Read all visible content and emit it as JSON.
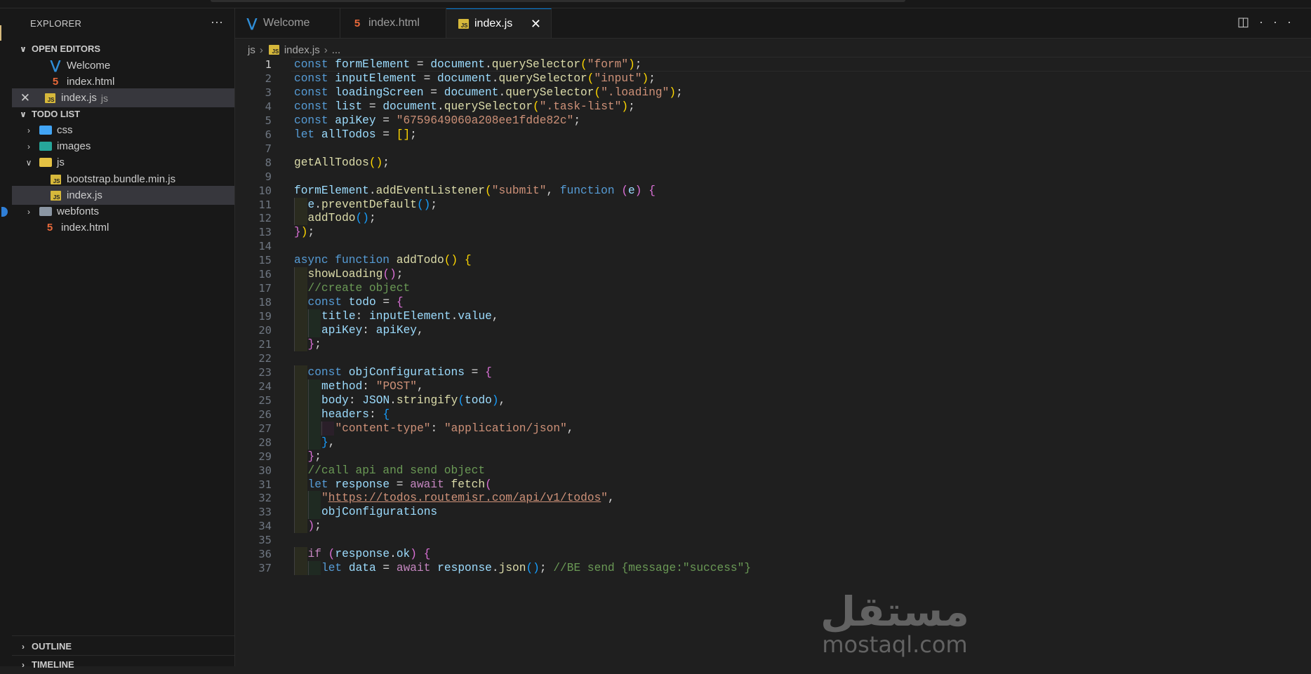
{
  "sidebar": {
    "title": "EXPLORER",
    "more": "···",
    "open_editors": {
      "label": "OPEN EDITORS",
      "items": [
        {
          "name": "Welcome"
        },
        {
          "name": "index.html"
        },
        {
          "name": "index.js",
          "hint": "js"
        }
      ]
    },
    "project": {
      "label": "TODO LIST",
      "items": [
        {
          "name": "css"
        },
        {
          "name": "images"
        },
        {
          "name": "js"
        },
        {
          "name": "bootstrap.bundle.min.js"
        },
        {
          "name": "index.js"
        },
        {
          "name": "webfonts"
        },
        {
          "name": "index.html"
        }
      ]
    },
    "outline": "OUTLINE",
    "timeline": "TIMELINE"
  },
  "tabs": [
    {
      "label": "Welcome"
    },
    {
      "label": "index.html"
    },
    {
      "label": "index.js",
      "active": true
    }
  ],
  "breadcrumb": {
    "folder": "js",
    "file": "index.js",
    "rest": "..."
  },
  "watermark": {
    "arabic": "مستقل",
    "latin": "mostaql.com"
  },
  "code": {
    "first_line_number": 1,
    "active_line": 1,
    "lines": [
      [
        [
          "k",
          "const "
        ],
        [
          "v",
          "formElement"
        ],
        [
          "p",
          " = "
        ],
        [
          "v",
          "document"
        ],
        [
          "p",
          "."
        ],
        [
          "f",
          "querySelector"
        ],
        [
          "b1",
          "("
        ],
        [
          "s",
          "\"form\""
        ],
        [
          "b1",
          ")"
        ],
        [
          "p",
          ";"
        ]
      ],
      [
        [
          "k",
          "const "
        ],
        [
          "v",
          "inputElement"
        ],
        [
          "p",
          " = "
        ],
        [
          "v",
          "document"
        ],
        [
          "p",
          "."
        ],
        [
          "f",
          "querySelector"
        ],
        [
          "b1",
          "("
        ],
        [
          "s",
          "\"input\""
        ],
        [
          "b1",
          ")"
        ],
        [
          "p",
          ";"
        ]
      ],
      [
        [
          "k",
          "const "
        ],
        [
          "v",
          "loadingScreen"
        ],
        [
          "p",
          " = "
        ],
        [
          "v",
          "document"
        ],
        [
          "p",
          "."
        ],
        [
          "f",
          "querySelector"
        ],
        [
          "b1",
          "("
        ],
        [
          "s",
          "\".loading\""
        ],
        [
          "b1",
          ")"
        ],
        [
          "p",
          ";"
        ]
      ],
      [
        [
          "k",
          "const "
        ],
        [
          "v",
          "list"
        ],
        [
          "p",
          " = "
        ],
        [
          "v",
          "document"
        ],
        [
          "p",
          "."
        ],
        [
          "f",
          "querySelector"
        ],
        [
          "b1",
          "("
        ],
        [
          "s",
          "\".task-list\""
        ],
        [
          "b1",
          ")"
        ],
        [
          "p",
          ";"
        ]
      ],
      [
        [
          "k",
          "const "
        ],
        [
          "v",
          "apiKey"
        ],
        [
          "p",
          " = "
        ],
        [
          "s",
          "\"6759649060a208ee1fdde82c\""
        ],
        [
          "p",
          ";"
        ]
      ],
      [
        [
          "k",
          "let "
        ],
        [
          "v",
          "allTodos"
        ],
        [
          "p",
          " = "
        ],
        [
          "b1",
          "[]"
        ],
        [
          "p",
          ";"
        ]
      ],
      [],
      [
        [
          "f",
          "getAllTodos"
        ],
        [
          "b1",
          "()"
        ],
        [
          "p",
          ";"
        ]
      ],
      [],
      [
        [
          "v",
          "formElement"
        ],
        [
          "p",
          "."
        ],
        [
          "f",
          "addEventListener"
        ],
        [
          "b1",
          "("
        ],
        [
          "s",
          "\"submit\""
        ],
        [
          "p",
          ", "
        ],
        [
          "k",
          "function "
        ],
        [
          "b2",
          "("
        ],
        [
          "v",
          "e"
        ],
        [
          "b2",
          ")"
        ],
        [
          "p",
          " "
        ],
        [
          "b2",
          "{"
        ]
      ],
      [
        [
          "v",
          "e"
        ],
        [
          "p",
          "."
        ],
        [
          "f",
          "preventDefault"
        ],
        [
          "b3",
          "()"
        ],
        [
          "p",
          ";"
        ]
      ],
      [
        [
          "f",
          "addTodo"
        ],
        [
          "b3",
          "()"
        ],
        [
          "p",
          ";"
        ]
      ],
      [
        [
          "b2",
          "}"
        ],
        [
          "b1",
          ")"
        ],
        [
          "p",
          ";"
        ]
      ],
      [],
      [
        [
          "k",
          "async "
        ],
        [
          "k",
          "function "
        ],
        [
          "f",
          "addTodo"
        ],
        [
          "b1",
          "()"
        ],
        [
          "p",
          " "
        ],
        [
          "b1",
          "{"
        ]
      ],
      [
        [
          "f",
          "showLoading"
        ],
        [
          "b2",
          "()"
        ],
        [
          "p",
          ";"
        ]
      ],
      [
        [
          "cm",
          "//create object"
        ]
      ],
      [
        [
          "k",
          "const "
        ],
        [
          "v",
          "todo"
        ],
        [
          "p",
          " = "
        ],
        [
          "b2",
          "{"
        ]
      ],
      [
        [
          "v",
          "title"
        ],
        [
          "p",
          ": "
        ],
        [
          "v",
          "inputElement"
        ],
        [
          "p",
          "."
        ],
        [
          "v",
          "value"
        ],
        [
          "p",
          ","
        ]
      ],
      [
        [
          "v",
          "apiKey"
        ],
        [
          "p",
          ": "
        ],
        [
          "v",
          "apiKey"
        ],
        [
          "p",
          ","
        ]
      ],
      [
        [
          "b2",
          "}"
        ],
        [
          "p",
          ";"
        ]
      ],
      [],
      [
        [
          "k",
          "const "
        ],
        [
          "v",
          "objConfigurations"
        ],
        [
          "p",
          " = "
        ],
        [
          "b2",
          "{"
        ]
      ],
      [
        [
          "v",
          "method"
        ],
        [
          "p",
          ": "
        ],
        [
          "s",
          "\"POST\""
        ],
        [
          "p",
          ","
        ]
      ],
      [
        [
          "v",
          "body"
        ],
        [
          "p",
          ": "
        ],
        [
          "v",
          "JSON"
        ],
        [
          "p",
          "."
        ],
        [
          "f",
          "stringify"
        ],
        [
          "b3",
          "("
        ],
        [
          "v",
          "todo"
        ],
        [
          "b3",
          ")"
        ],
        [
          "p",
          ","
        ]
      ],
      [
        [
          "v",
          "headers"
        ],
        [
          "p",
          ": "
        ],
        [
          "b3",
          "{"
        ]
      ],
      [
        [
          "s",
          "\"content-type\""
        ],
        [
          "p",
          ": "
        ],
        [
          "s",
          "\"application/json\""
        ],
        [
          "p",
          ","
        ]
      ],
      [
        [
          "b3",
          "}"
        ],
        [
          "p",
          ","
        ]
      ],
      [
        [
          "b2",
          "}"
        ],
        [
          "p",
          ";"
        ]
      ],
      [
        [
          "cm",
          "//call api and send object"
        ]
      ],
      [
        [
          "k",
          "let "
        ],
        [
          "v",
          "response"
        ],
        [
          "p",
          " = "
        ],
        [
          "c",
          "await "
        ],
        [
          "f",
          "fetch"
        ],
        [
          "b2",
          "("
        ]
      ],
      [
        [
          "s",
          "\""
        ],
        [
          "su",
          "https://todos.routemisr.com/api/v1/todos"
        ],
        [
          "s",
          "\""
        ],
        [
          "p",
          ","
        ]
      ],
      [
        [
          "v",
          "objConfigurations"
        ]
      ],
      [
        [
          "b2",
          ")"
        ],
        [
          "p",
          ";"
        ]
      ],
      [],
      [
        [
          "c",
          "if "
        ],
        [
          "b2",
          "("
        ],
        [
          "v",
          "response"
        ],
        [
          "p",
          "."
        ],
        [
          "v",
          "ok"
        ],
        [
          "b2",
          ")"
        ],
        [
          "p",
          " "
        ],
        [
          "b2",
          "{"
        ]
      ],
      [
        [
          "k",
          "let "
        ],
        [
          "v",
          "data"
        ],
        [
          "p",
          " = "
        ],
        [
          "c",
          "await "
        ],
        [
          "v",
          "response"
        ],
        [
          "p",
          "."
        ],
        [
          "f",
          "json"
        ],
        [
          "b3",
          "()"
        ],
        [
          "p",
          "; "
        ],
        [
          "cm",
          "//BE send {message:\"success\"}"
        ]
      ]
    ]
  }
}
